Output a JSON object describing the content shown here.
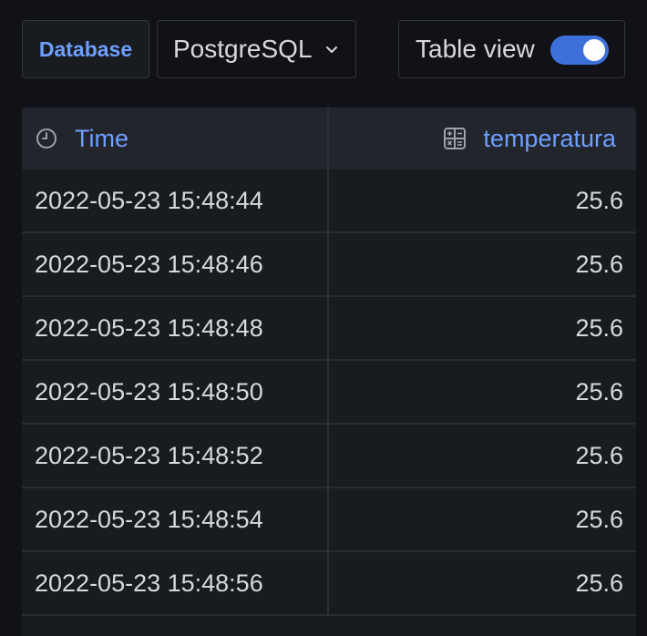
{
  "toolbar": {
    "database_label": "Database",
    "database_value": "PostgreSQL",
    "table_view_label": "Table view",
    "table_view_on": true
  },
  "table": {
    "columns": [
      {
        "label": "Time",
        "icon": "clock-icon"
      },
      {
        "label": "temperatura",
        "icon": "calculator-icon"
      }
    ],
    "rows": [
      {
        "time": "2022-05-23 15:48:44",
        "temperatura": "25.6"
      },
      {
        "time": "2022-05-23 15:48:46",
        "temperatura": "25.6"
      },
      {
        "time": "2022-05-23 15:48:48",
        "temperatura": "25.6"
      },
      {
        "time": "2022-05-23 15:48:50",
        "temperatura": "25.6"
      },
      {
        "time": "2022-05-23 15:48:52",
        "temperatura": "25.6"
      },
      {
        "time": "2022-05-23 15:48:54",
        "temperatura": "25.6"
      },
      {
        "time": "2022-05-23 15:48:56",
        "temperatura": "25.6"
      }
    ]
  },
  "colors": {
    "accent": "#6e9fff",
    "toggle": "#3d71d9",
    "background": "#111217",
    "panel": "#181b1f"
  }
}
